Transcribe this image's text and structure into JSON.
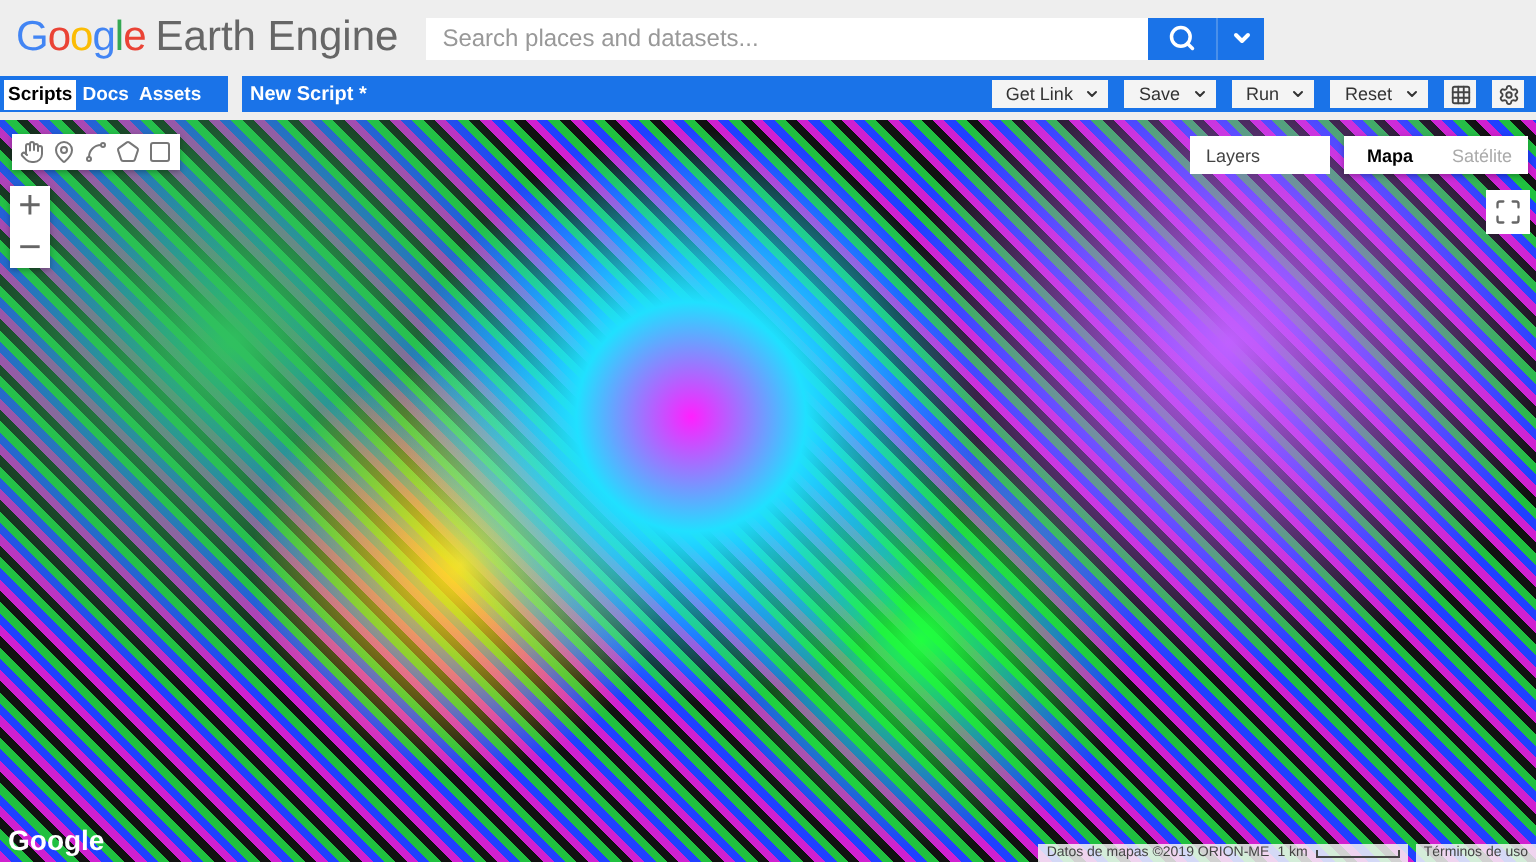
{
  "header": {
    "logo_brand": "Google",
    "logo_product": "Earth Engine",
    "search": {
      "placeholder": "Search places and datasets..."
    }
  },
  "left_tabs": [
    {
      "label": "Scripts",
      "selected": true
    },
    {
      "label": "Docs",
      "selected": false
    },
    {
      "label": "Assets",
      "selected": false
    }
  ],
  "editor": {
    "title": "New Script *",
    "buttons": [
      "Get Link",
      "Save",
      "Run",
      "Reset"
    ]
  },
  "map": {
    "layers_label": "Layers",
    "map_types": [
      {
        "label": "Mapa",
        "selected": true
      },
      {
        "label": "Satélite",
        "selected": false
      }
    ],
    "zoom_in": "+",
    "zoom_out": "−",
    "footer_logo": "Google",
    "attribution": "Datos de mapas ©2019 ORION-ME",
    "scale": "1 km",
    "terms": "Términos de uso"
  }
}
